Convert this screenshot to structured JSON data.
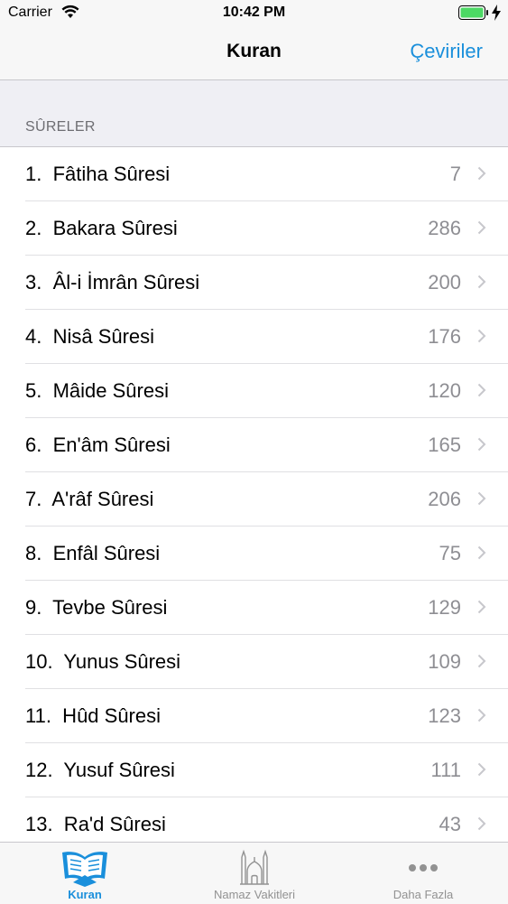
{
  "status": {
    "carrier": "Carrier",
    "time": "10:42 PM"
  },
  "nav": {
    "title": "Kuran",
    "right_button": "Çeviriler"
  },
  "section": {
    "header": "SÛRELER"
  },
  "surahs": [
    {
      "label": "1.  Fâtiha Sûresi",
      "count": "7"
    },
    {
      "label": "2.  Bakara Sûresi",
      "count": "286"
    },
    {
      "label": "3.  Âl-i İmrân Sûresi",
      "count": "200"
    },
    {
      "label": "4.  Nisâ Sûresi",
      "count": "176"
    },
    {
      "label": "5.  Mâide Sûresi",
      "count": "120"
    },
    {
      "label": "6.  En'âm Sûresi",
      "count": "165"
    },
    {
      "label": "7.  A'râf Sûresi",
      "count": "206"
    },
    {
      "label": "8.  Enfâl Sûresi",
      "count": "75"
    },
    {
      "label": "9.  Tevbe Sûresi",
      "count": "129"
    },
    {
      "label": "10.  Yunus Sûresi",
      "count": "109"
    },
    {
      "label": "11.  Hûd Sûresi",
      "count": "123"
    },
    {
      "label": "12.  Yusuf Sûresi",
      "count": "111"
    },
    {
      "label": "13.  Ra'd Sûresi",
      "count": "43"
    }
  ],
  "tabs": [
    {
      "label": "Kuran",
      "icon": "quran-book-icon",
      "active": true
    },
    {
      "label": "Namaz Vakitleri",
      "icon": "mosque-icon",
      "active": false
    },
    {
      "label": "Daha Fazla",
      "icon": "more-dots-icon",
      "active": false
    }
  ],
  "colors": {
    "accent": "#1a8fdb",
    "battery": "#4cd964"
  }
}
